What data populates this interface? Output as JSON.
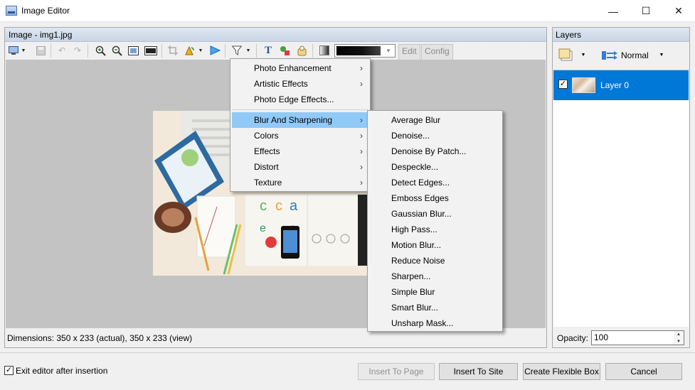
{
  "window": {
    "title": "Image Editor",
    "minimize_glyph": "—",
    "maximize_glyph": "☐",
    "close_glyph": "✕"
  },
  "image_panel": {
    "title": "Image - img1.jpg",
    "status": "Dimensions: 350 x 233 (actual),  350 x 233 (view)",
    "toolbar": {
      "edit_label": "Edit",
      "config_label": "Config",
      "text_tool_glyph": "T"
    }
  },
  "filter_menu": {
    "items": [
      {
        "label": "Photo Enhancement",
        "submenu": true
      },
      {
        "label": "Artistic Effects",
        "submenu": true
      },
      {
        "label": "Photo Edge Effects...",
        "submenu": false
      },
      {
        "label": "Blur And Sharpening",
        "submenu": true,
        "highlighted": true
      },
      {
        "label": "Colors",
        "submenu": true
      },
      {
        "label": "Effects",
        "submenu": true
      },
      {
        "label": "Distort",
        "submenu": true
      },
      {
        "label": "Texture",
        "submenu": true
      }
    ]
  },
  "blur_submenu": {
    "items": [
      "Average Blur",
      "Denoise...",
      "Denoise By Patch...",
      "Despeckle...",
      "Detect Edges...",
      "Emboss Edges",
      "Gaussian Blur...",
      "High Pass...",
      "Motion Blur...",
      "Reduce Noise",
      "Sharpen...",
      "Simple Blur",
      "Smart Blur...",
      "Unsharp Mask..."
    ]
  },
  "layers_panel": {
    "title": "Layers",
    "blend_mode": "Normal",
    "layers": [
      {
        "name": "Layer 0",
        "visible": true,
        "selected": true
      }
    ],
    "opacity_label": "Opacity:",
    "opacity_value": "100"
  },
  "bottom": {
    "exit_label": "Exit editor after insertion",
    "exit_checked": true,
    "buttons": {
      "insert_to_page": "Insert To Page",
      "insert_to_site": "Insert To Site",
      "create_flexible_box": "Create Flexible Box",
      "cancel": "Cancel"
    }
  },
  "colors": {
    "selection": "#0078d7",
    "menu_highlight": "#91c9f7",
    "canvas": "#c3c3c3"
  }
}
